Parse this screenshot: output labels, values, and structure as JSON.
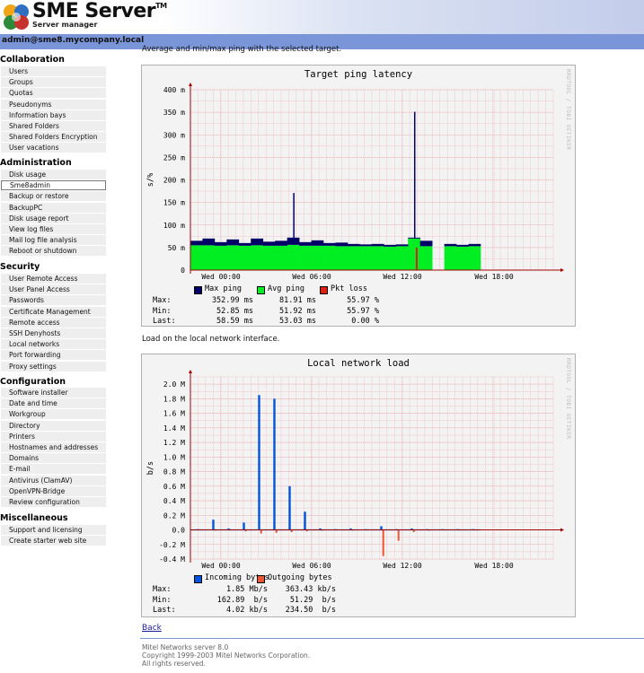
{
  "app": {
    "title": "SME Server",
    "trademark": "TM",
    "subtitle": "Server manager",
    "user": "admin@sme8.mycompany.local"
  },
  "sidebar": {
    "sections": [
      {
        "title": "Collaboration",
        "items": [
          "Users",
          "Groups",
          "Quotas",
          "Pseudonyms",
          "Information bays",
          "Shared Folders",
          "Shared Folders Encryption",
          "User vacations"
        ]
      },
      {
        "title": "Administration",
        "items": [
          "Disk usage",
          "Sme8admin",
          "Backup or restore",
          "BackupPC",
          "Disk usage report",
          "View log files",
          "Mail log file analysis",
          "Reboot or shutdown"
        ],
        "active_index": 1
      },
      {
        "title": "Security",
        "items": [
          "User Remote Access",
          "User Panel Access",
          "Passwords",
          "Certificate Management",
          "Remote access",
          "SSH Denyhosts",
          "Local networks",
          "Port forwarding",
          "Proxy settings"
        ]
      },
      {
        "title": "Configuration",
        "items": [
          "Software installer",
          "Date and time",
          "Workgroup",
          "Directory",
          "Printers",
          "Hostnames and addresses",
          "Domains",
          "E-mail",
          "Antivirus (ClamAV)",
          "OpenVPN-Bridge",
          "Review configuration"
        ]
      },
      {
        "title": "Miscellaneous",
        "items": [
          "Support and licensing",
          "Create starter web site"
        ]
      }
    ]
  },
  "main": {
    "intro1": "Average and min/max ping with the selected target.",
    "intro2": "Load on the local network interface.",
    "back": "Back",
    "footer": [
      "Mitel Networks server 8.0",
      "Copyright 1999-2003 Mitel Networks Corporation.",
      "All rights reserved."
    ]
  },
  "chart_data": [
    {
      "type": "area",
      "title": "Target ping latency",
      "ylabel": "s/%",
      "watermark": "RRDTOOL / TOBI OETIKER",
      "ytick_labels": [
        "0",
        "50 m",
        "100 m",
        "150 m",
        "200 m",
        "250 m",
        "300 m",
        "350 m",
        "400 m"
      ],
      "ylim": [
        0,
        0.4
      ],
      "xtick_labels": [
        "Wed 00:00",
        "Wed 06:00",
        "Wed 12:00",
        "Wed 18:00"
      ],
      "series": [
        {
          "name": "Max ping",
          "color": "#000066",
          "values": [
            0.065,
            0.07,
            0.062,
            0.068,
            0.06,
            0.07,
            0.063,
            0.065,
            0.171,
            0.062,
            0.066,
            0.06,
            0.061,
            0.058,
            0.057,
            0.058,
            0.056,
            0.057,
            0.351,
            0.065,
            0.055,
            0.058,
            0.056,
            0.058
          ]
        },
        {
          "name": "Avg ping",
          "color": "#00ee22",
          "values": [
            0.055,
            0.055,
            0.054,
            0.055,
            0.054,
            0.055,
            0.054,
            0.054,
            0.056,
            0.054,
            0.054,
            0.054,
            0.053,
            0.053,
            0.053,
            0.053,
            0.052,
            0.053,
            0.07,
            0.053,
            0,
            0.053,
            0.052,
            0.053
          ]
        },
        {
          "name": "Pkt loss",
          "color": "#dd2211",
          "values": [
            0,
            0,
            0,
            0,
            0,
            0,
            0,
            0,
            0,
            0,
            0,
            0,
            0,
            0,
            0,
            0,
            0,
            0,
            0.05,
            0,
            0,
            0,
            0,
            0
          ]
        }
      ],
      "legend": [
        {
          "name": "Max ping",
          "color": "#000066"
        },
        {
          "name": "Avg ping",
          "color": "#00ee22"
        },
        {
          "name": "Pkt loss",
          "color": "#dd2211"
        }
      ],
      "stats": [
        {
          "label": "Max:",
          "values": [
            "352.99 ms",
            "81.91 ms",
            "55.97 %"
          ]
        },
        {
          "label": "Min:",
          "values": [
            "52.85 ms",
            "51.92 ms",
            "55.97 %"
          ]
        },
        {
          "label": "Last:",
          "values": [
            "58.59 ms",
            "53.03 ms",
            "0.00 %"
          ]
        }
      ]
    },
    {
      "type": "bar",
      "title": "Local network load",
      "ylabel": "b/s",
      "watermark": "RRDTOOL / TOBI OETIKER",
      "ytick_labels": [
        "-0.4 M",
        "-0.2 M",
        "0.0",
        "0.2 M",
        "0.4 M",
        "0.6 M",
        "0.8 M",
        "1.0 M",
        "1.2 M",
        "1.4 M",
        "1.6 M",
        "1.8 M",
        "2.0 M"
      ],
      "ylim": [
        -400000,
        2100000
      ],
      "xtick_labels": [
        "Wed 00:00",
        "Wed 06:00",
        "Wed 12:00",
        "Wed 18:00"
      ],
      "series": [
        {
          "name": "Incoming bytes",
          "color": "#0055dd",
          "values": [
            0.01,
            0.14,
            0.02,
            0.1,
            1.85,
            1.8,
            0.6,
            0.25,
            0.02,
            0.01,
            0.02,
            0.01,
            0.05,
            0.01,
            0.02,
            0.01,
            0.01,
            0.01,
            0.01
          ]
        },
        {
          "name": "Outgoing bytes",
          "color": "#ee5533",
          "values": [
            0.005,
            0.01,
            0.005,
            0.02,
            0.05,
            0.04,
            0.03,
            0.02,
            0.01,
            0.005,
            0.01,
            0.005,
            0.36,
            0.15,
            0.03,
            0.01,
            0.005,
            0.005,
            0.005
          ]
        }
      ],
      "legend": [
        {
          "name": "Incoming bytes",
          "color": "#0055dd"
        },
        {
          "name": "Outgoing bytes",
          "color": "#ee5533"
        }
      ],
      "stats": [
        {
          "label": "Max:",
          "values": [
            "1.85 Mb/s",
            "363.43 kb/s"
          ]
        },
        {
          "label": "Min:",
          "values": [
            "162.89  b/s",
            "51.29  b/s"
          ]
        },
        {
          "label": "Last:",
          "values": [
            "4.02 kb/s",
            "234.50  b/s"
          ]
        }
      ]
    }
  ]
}
